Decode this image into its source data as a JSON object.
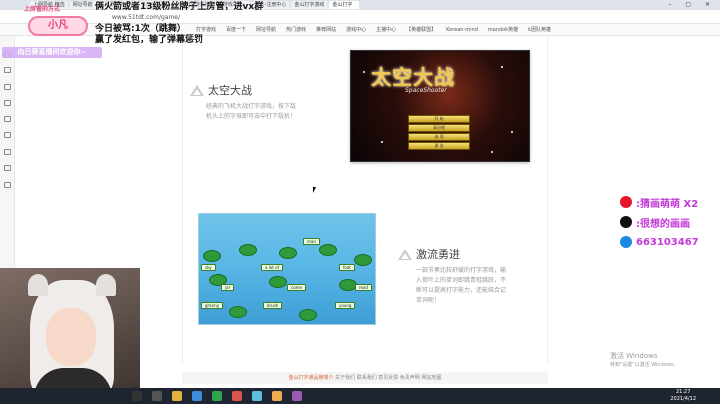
{
  "browser": {
    "tabs": [
      "上网导航·精选",
      "网址导航",
      "免费游戏大全",
      "4399小游戏",
      "hzygt_游戏推荐",
      "游戏攻略",
      "点击·注册中心",
      "金山打字游戏",
      "金山打字"
    ],
    "address": "www.51tdt.com/game/",
    "bookmarks": [
      "打字游戏",
      "百度一下",
      "网址导航",
      "热门游戏",
      "推荐网站",
      "游戏中心",
      "主播中心",
      "【英雄联盟】",
      "Korean-mind",
      "mandok英雄",
      "k团队英雄"
    ]
  },
  "features": [
    {
      "title": "太空大战",
      "desc": [
        "经典的飞机大战打字游戏，按下敌",
        "机头上的字母即可击中打下敌机！"
      ],
      "game": {
        "title": "太空大战",
        "subtitle": "SpaceShooter",
        "menu": [
          "开 始",
          "高分榜",
          "选 项",
          "退 出"
        ]
      }
    },
    {
      "title": "激流勇进",
      "desc": [
        "一款节奏比较舒缓的打字游戏，输",
        "入荷叶上的单词即跳青蛙跳跃，不",
        "断可以提高打字能力，还能结合记",
        "单词呢！"
      ],
      "game": {
        "words": [
          "man",
          "sky",
          "a lot of",
          "foot",
          "jar",
          "come",
          "read",
          "granny",
          "brush",
          "young"
        ]
      }
    }
  ],
  "footer": {
    "highlight": "金山打字通品牌简介",
    "text": "关于我们  联系我们  意见反馈  免责声明  网站地图"
  },
  "overlay": {
    "top_line": "俩火箭或者13级粉丝牌子上房管，进vx群",
    "line2": "今日被骂:1次（跳舞）",
    "line3": "赢了发红包，输了弹幕惩罚",
    "logo_top": "上房管的方式",
    "logo_name": "小凡",
    "logo_sub": "向日葵直播间欢迎你~",
    "social": [
      {
        "icon": "weibo-icon",
        "text": ":猜画萌萌 X2",
        "color": "#e6162d"
      },
      {
        "icon": "douyin-icon",
        "text": ":很想的画画",
        "color": "#111111"
      },
      {
        "icon": "qq-icon",
        "text": "663103467",
        "color": "#1a8be0"
      }
    ]
  },
  "activate": {
    "line1": "激活 Windows",
    "line2": "转到\"设置\"以激活 Windows。"
  },
  "taskbar": {
    "time": "21:27",
    "date": "2021/4/12"
  }
}
